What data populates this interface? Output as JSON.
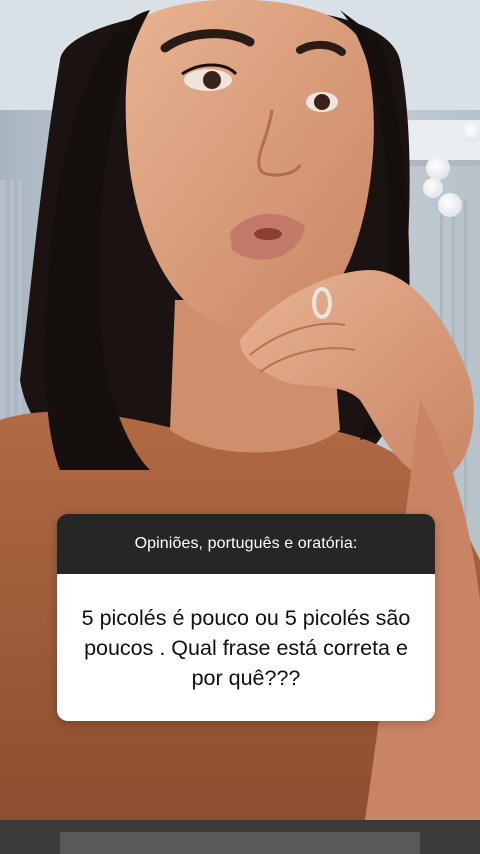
{
  "question_box": {
    "prompt": "Opiniões, português e oratória:",
    "answer": "5 picolés é pouco ou 5 picolés são poucos . Qual frase está correta e por quê???"
  },
  "colors": {
    "sticker_header": "#262626",
    "sticker_body": "#ffffff",
    "wall": "#c9d3dc",
    "hair": "#1a1311",
    "skin": "#d79d7b",
    "sweater": "#a35f3b"
  }
}
